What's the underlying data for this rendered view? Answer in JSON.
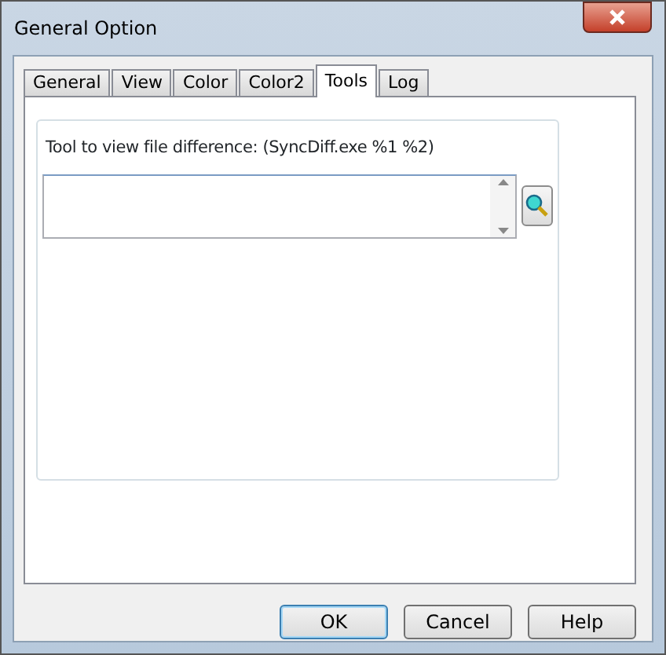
{
  "window": {
    "title": "General Option"
  },
  "tabs": [
    {
      "label": "General",
      "selected": false
    },
    {
      "label": "View",
      "selected": false
    },
    {
      "label": "Color",
      "selected": false
    },
    {
      "label": "Color2",
      "selected": false
    },
    {
      "label": "Tools",
      "selected": true
    },
    {
      "label": "Log",
      "selected": false
    }
  ],
  "tools": {
    "label": "Tool to view file difference: (SyncDiff.exe %1 %2)"
  },
  "buttons": [
    {
      "label": "OK",
      "default": true
    },
    {
      "label": "Cancel",
      "default": false
    },
    {
      "label": "Help",
      "default": false
    }
  ]
}
